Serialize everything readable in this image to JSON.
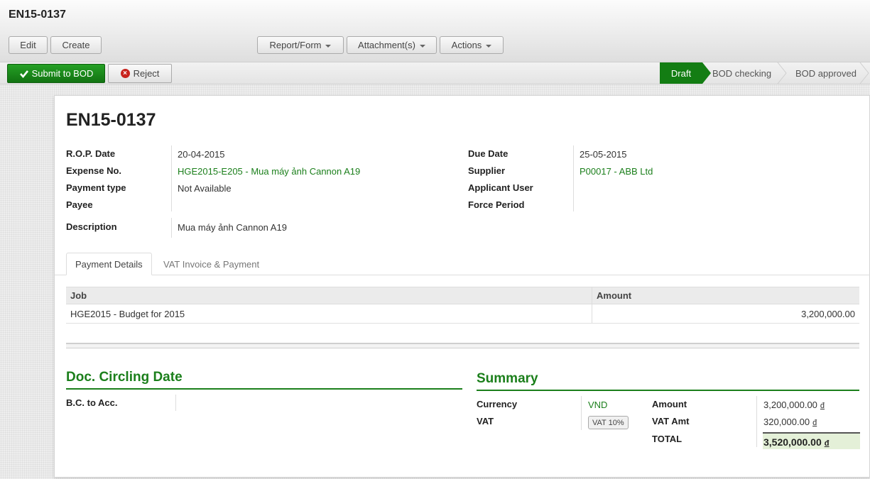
{
  "header": {
    "title": "EN15-0137",
    "edit_label": "Edit",
    "create_label": "Create",
    "report_label": "Report/Form",
    "attachment_label": "Attachment(s)",
    "actions_label": "Actions"
  },
  "statusbar": {
    "submit_label": "Submit to BOD",
    "reject_label": "Reject",
    "stages": [
      "Draft",
      "BOD checking",
      "BOD approved"
    ],
    "active_stage": "Draft"
  },
  "doc": {
    "title": "EN15-0137",
    "rop_date_label": "R.O.P. Date",
    "rop_date": "20-04-2015",
    "expense_no_label": "Expense No.",
    "expense_no": "HGE2015-E205 - Mua máy ảnh Cannon A19",
    "payment_type_label": "Payment type",
    "payment_type": "Not Available",
    "payee_label": "Payee",
    "payee": "",
    "description_label": "Description",
    "description": "Mua máy ảnh Cannon A19",
    "due_date_label": "Due Date",
    "due_date": "25-05-2015",
    "supplier_label": "Supplier",
    "supplier": "P00017 - ABB Ltd",
    "applicant_label": "Applicant User",
    "applicant": "",
    "force_period_label": "Force Period",
    "force_period": ""
  },
  "tabs": [
    {
      "label": "Payment Details",
      "active": true
    },
    {
      "label": "VAT Invoice & Payment",
      "active": false
    }
  ],
  "table": {
    "columns": [
      "Job",
      "Amount"
    ],
    "rows": [
      {
        "job": "HGE2015 - Budget for 2015",
        "amount": "3,200,000.00"
      }
    ]
  },
  "circling": {
    "title": "Doc. Circling Date",
    "bc_label": "B.C. to Acc.",
    "bc_value": ""
  },
  "summary": {
    "title": "Summary",
    "currency_label": "Currency",
    "currency": "VND",
    "vat_label": "VAT",
    "vat": "VAT 10%",
    "amount_label": "Amount",
    "amount": "3,200,000.00",
    "vat_amt_label": "VAT Amt",
    "vat_amt": "320,000.00",
    "total_label": "TOTAL",
    "total": "3,520,000.00",
    "currency_symbol": "đ"
  },
  "colors": {
    "accent_green": "#1b7f1b",
    "submit_green": "#137d13",
    "reject_red": "#c8231d",
    "total_bg": "#e4f0d8"
  }
}
